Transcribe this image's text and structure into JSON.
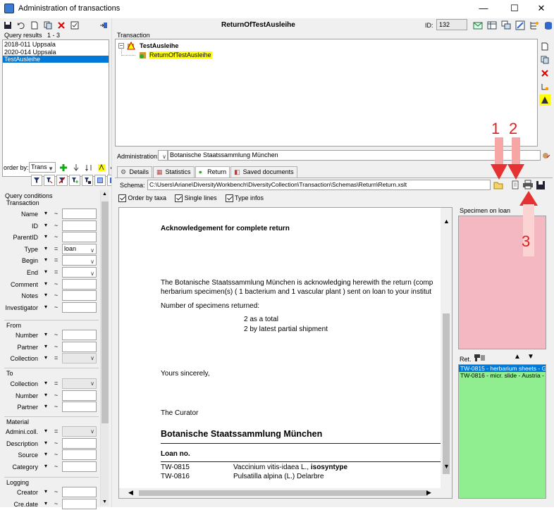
{
  "window": {
    "title": "Administration of transactions",
    "minimize": "—",
    "maximize": "☐",
    "close": "✕"
  },
  "query": {
    "results_label": "Query results",
    "results_range": "1 - 3",
    "items": [
      "2018-011 Uppsala",
      "2020-014 Uppsala",
      "TestAusleihe"
    ],
    "selected_index": 2,
    "order_by_label": "order by:",
    "order_by_value": "Trans",
    "conditions_label": "Query conditions"
  },
  "conditions": {
    "transaction_label": "Transaction",
    "fields": [
      {
        "label": "Name",
        "op": "~",
        "value": ""
      },
      {
        "label": "ID",
        "op": "~",
        "value": ""
      },
      {
        "label": "ParentID",
        "op": "~",
        "value": ""
      },
      {
        "label": "Type",
        "op": "=",
        "value": "loan"
      },
      {
        "label": "Begin",
        "op": "=",
        "value": ""
      },
      {
        "label": "End",
        "op": "=",
        "value": ""
      },
      {
        "label": "Comment",
        "op": "~",
        "value": ""
      },
      {
        "label": "Notes",
        "op": "~",
        "value": ""
      },
      {
        "label": "Investigator",
        "op": "~",
        "value": ""
      }
    ],
    "from_label": "From",
    "from_fields": [
      {
        "label": "Number",
        "op": "~"
      },
      {
        "label": "Partner",
        "op": "~"
      },
      {
        "label": "Collection",
        "op": "="
      }
    ],
    "to_label": "To",
    "to_fields": [
      {
        "label": "Collection",
        "op": "="
      },
      {
        "label": "Number",
        "op": "~"
      },
      {
        "label": "Partner",
        "op": "~"
      }
    ],
    "material_label": "Material",
    "material_fields": [
      {
        "label": "Admini.coll.",
        "op": "="
      },
      {
        "label": "Description",
        "op": "~"
      },
      {
        "label": "Source",
        "op": "~"
      },
      {
        "label": "Category",
        "op": "~"
      }
    ],
    "logging_label": "Logging",
    "logging_fields": [
      {
        "label": "Creator",
        "op": "~"
      },
      {
        "label": "Cre.date",
        "op": "~"
      }
    ]
  },
  "header": {
    "name": "ReturnOfTestAusleihe",
    "id_label": "ID:",
    "id_value": "132"
  },
  "transaction": {
    "label": "Transaction",
    "root": "TestAusleihe",
    "child": "ReturnOfTestAusleihe"
  },
  "administration": {
    "label": "Administration:",
    "value": "Botanische Staatssammlung München"
  },
  "tabs": [
    "Details",
    "Statistics",
    "Return",
    "Saved documents"
  ],
  "active_tab": 2,
  "schema": {
    "label": "Schema:",
    "path": "C:\\Users\\Ariane\\DiversityWorkbench\\DiversityCollection\\Transaction\\Schemas\\Return\\Return.xslt"
  },
  "options": {
    "order_by_taxa": "Order by taxa",
    "single_lines": "Single lines",
    "type_infos": "Type infos"
  },
  "document": {
    "heading": "Acknowledgement for complete return",
    "para1": "The Botanische Staatssammlung München is acknowledging herewith the return (comp",
    "para2": "herbarium specimen(s) ( 1 bacterium and 1 vascular plant ) sent on loan to your institut",
    "returned_label": "Number of specimens returned:",
    "total": "2 as a total",
    "partial": "2 by latest partial shipment",
    "sincerely": "Yours sincerely,",
    "curator": "The Curator",
    "institution": "Botanische Staatssammlung München",
    "loan_no": "Loan no.",
    "rows": [
      {
        "no": "TW-0815",
        "taxon": "Vaccinium vitis-idaea L., ",
        "status": "isosyntype"
      },
      {
        "no": "TW-0816",
        "taxon": "Pulsatilla alpina (L.) Delarbre",
        "status": ""
      }
    ]
  },
  "specimen": {
    "label": "Specimen on loan",
    "ret_label": "Ret.",
    "items": [
      "TW-0815 - herbarium sheets - G",
      "TW-0816 - micr. slide - Austria -"
    ]
  },
  "callouts": [
    "1",
    "2",
    "3"
  ],
  "colors": {
    "selection": "#0078d7",
    "pink": "#f4b8c3",
    "green": "#90ee90",
    "highlight": "#ffff00",
    "callout": "#e0201e"
  }
}
